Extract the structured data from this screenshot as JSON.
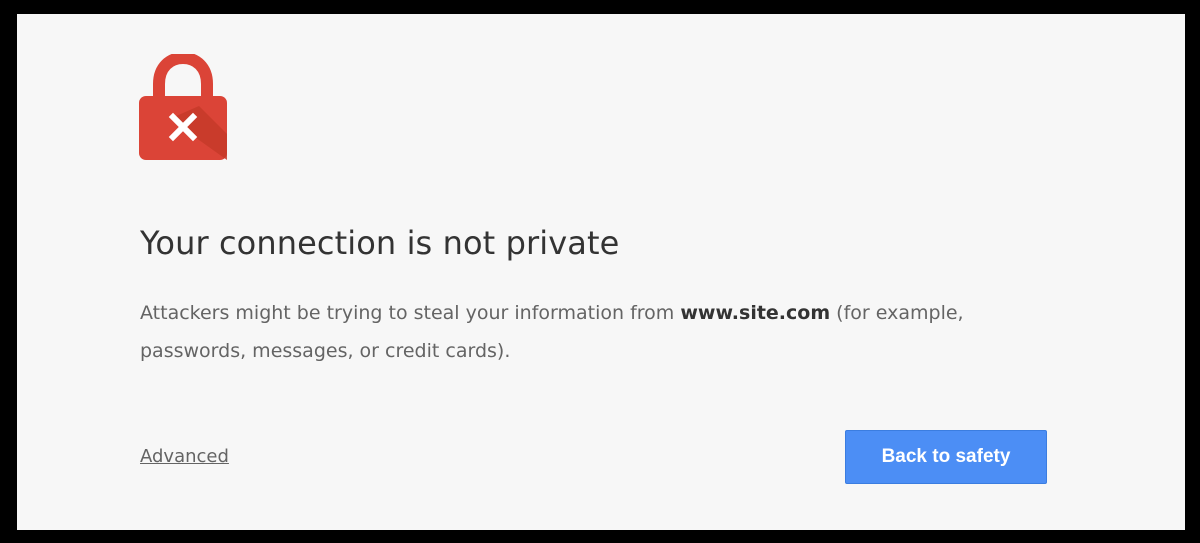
{
  "interstitial": {
    "lock_icon": "lock-error-icon",
    "title": "Your connection is not private",
    "message_prefix": "Attackers might be trying to steal your information from ",
    "host": "www.site.com",
    "message_suffix": " (for example, passwords, messages, or credit cards).",
    "advanced_label": "Advanced",
    "back_button_label": "Back to safety"
  },
  "colors": {
    "background": "#f7f7f7",
    "frame": "#000000",
    "lock_red": "#db4437",
    "button_blue": "#4c8ef5",
    "title_text": "#333333",
    "body_text": "#646464"
  }
}
